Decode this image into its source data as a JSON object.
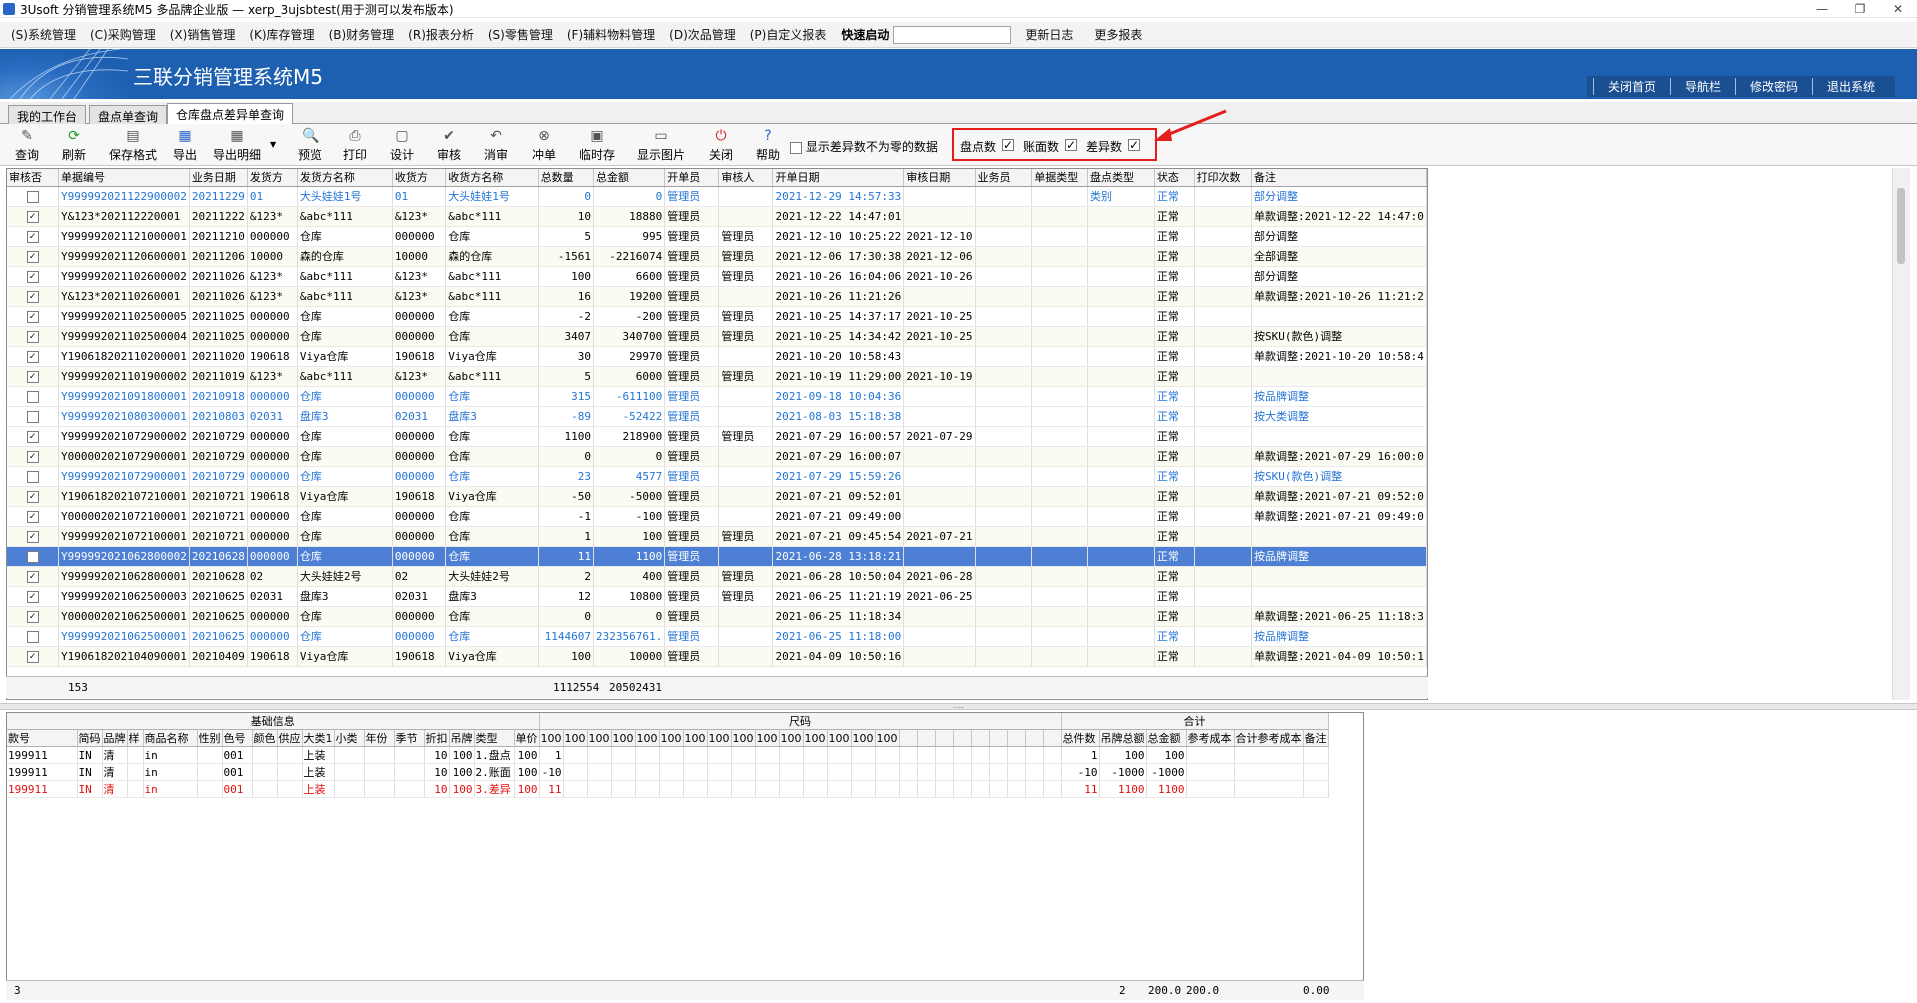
{
  "window": {
    "title": "3Usoft 分销管理系统M5 多品牌企业版 — xerp_3ujsbtest(用于测可以发布版本)",
    "controls": [
      "—",
      "❐",
      "✕"
    ]
  },
  "menubar": {
    "items": [
      "(S)系统管理",
      "(C)采购管理",
      "(X)销售管理",
      "(K)库存管理",
      "(B)财务管理",
      "(R)报表分析",
      "(S)零售管理",
      "(F)辅料物料管理",
      "(D)次品管理",
      "(P)自定义报表"
    ],
    "quick_label": "快速启动",
    "quick_value": "",
    "update_log": "更新日志",
    "more_reports": "更多报表"
  },
  "banner": {
    "title": "三联分销管理系统M5",
    "links": [
      "关闭首页",
      "导航栏",
      "修改密码",
      "退出系统"
    ]
  },
  "tabs": [
    "我的工作台",
    "盘点单查询",
    "仓库盘点差异单查询"
  ],
  "toolbar": {
    "buttons": [
      "查询",
      "刷新",
      "保存格式",
      "导出",
      "导出明细",
      "预览",
      "打印",
      "设计",
      "审核",
      "消审",
      "冲单",
      "临时存",
      "显示图片",
      "关闭",
      "帮助"
    ],
    "show_nonzero_label": "显示差异数不为零的数据",
    "show_nonzero_checked": false,
    "opts": [
      {
        "label": "盘点数",
        "checked": true
      },
      {
        "label": "账面数",
        "checked": true
      },
      {
        "label": "差异数",
        "checked": true
      }
    ]
  },
  "grid": {
    "columns": [
      "审核否",
      "单据编号",
      "业务日期",
      "发货方",
      "发货方名称",
      "收货方",
      "收货方名称",
      "总数量",
      "总金额",
      "开单员",
      "审核人",
      "开单日期",
      "审核日期",
      "业务员",
      "单据类型",
      "盘点类型",
      "状态",
      "打印次数",
      "备注"
    ],
    "rows": [
      {
        "chk": false,
        "style": "blue",
        "c": [
          "Y999992021122900002",
          "20211229",
          "01",
          "大头娃娃1号",
          "01",
          "大头娃娃1号",
          "0",
          "0",
          "管理员",
          "",
          "2021-12-29 14:57:33",
          "",
          "",
          "",
          "类别",
          "正常",
          "",
          "部分调整"
        ]
      },
      {
        "chk": true,
        "style": "alt",
        "c": [
          "Y&123*202112220001",
          "20211222",
          "&123*",
          "&abc*111",
          "&123*",
          "&abc*111",
          "10",
          "18880",
          "管理员",
          "",
          "2021-12-22 14:47:01",
          "",
          "",
          "",
          "",
          "正常",
          "",
          "单款调整:2021-12-22 14:47:0"
        ]
      },
      {
        "chk": true,
        "style": "",
        "c": [
          "Y999992021121000001",
          "20211210",
          "000000",
          "仓库",
          "000000",
          "仓库",
          "5",
          "995",
          "管理员",
          "管理员",
          "2021-12-10 10:25:22",
          "2021-12-10",
          "",
          "",
          "",
          "正常",
          "",
          "部分调整"
        ]
      },
      {
        "chk": true,
        "style": "alt",
        "c": [
          "Y999992021120600001",
          "20211206",
          "10000",
          "森的仓库",
          "10000",
          "森的仓库",
          "-1561",
          "-2216074",
          "管理员",
          "管理员",
          "2021-12-06 17:30:38",
          "2021-12-06",
          "",
          "",
          "",
          "正常",
          "",
          "全部调整"
        ]
      },
      {
        "chk": true,
        "style": "",
        "c": [
          "Y999992021102600002",
          "20211026",
          "&123*",
          "&abc*111",
          "&123*",
          "&abc*111",
          "100",
          "6600",
          "管理员",
          "管理员",
          "2021-10-26 16:04:06",
          "2021-10-26",
          "",
          "",
          "",
          "正常",
          "",
          "部分调整"
        ]
      },
      {
        "chk": true,
        "style": "alt",
        "c": [
          "Y&123*202110260001",
          "20211026",
          "&123*",
          "&abc*111",
          "&123*",
          "&abc*111",
          "16",
          "19200",
          "管理员",
          "",
          "2021-10-26 11:21:26",
          "",
          "",
          "",
          "",
          "正常",
          "",
          "单款调整:2021-10-26 11:21:2"
        ]
      },
      {
        "chk": true,
        "style": "",
        "c": [
          "Y999992021102500005",
          "20211025",
          "000000",
          "仓库",
          "000000",
          "仓库",
          "-2",
          "-200",
          "管理员",
          "管理员",
          "2021-10-25 14:37:17",
          "2021-10-25",
          "",
          "",
          "",
          "正常",
          "",
          ""
        ]
      },
      {
        "chk": true,
        "style": "alt",
        "c": [
          "Y999992021102500004",
          "20211025",
          "000000",
          "仓库",
          "000000",
          "仓库",
          "3407",
          "340700",
          "管理员",
          "管理员",
          "2021-10-25 14:34:42",
          "2021-10-25",
          "",
          "",
          "",
          "正常",
          "",
          "按SKU(款色)调整"
        ]
      },
      {
        "chk": true,
        "style": "",
        "c": [
          "Y190618202110200001",
          "20211020",
          "190618",
          "Viya仓库",
          "190618",
          "Viya仓库",
          "30",
          "29970",
          "管理员",
          "",
          "2021-10-20 10:58:43",
          "",
          "",
          "",
          "",
          "正常",
          "",
          "单款调整:2021-10-20 10:58:4"
        ]
      },
      {
        "chk": true,
        "style": "alt",
        "c": [
          "Y999992021101900002",
          "20211019",
          "&123*",
          "&abc*111",
          "&123*",
          "&abc*111",
          "5",
          "6000",
          "管理员",
          "管理员",
          "2021-10-19 11:29:00",
          "2021-10-19",
          "",
          "",
          "",
          "正常",
          "",
          ""
        ]
      },
      {
        "chk": false,
        "style": "blue",
        "c": [
          "Y999992021091800001",
          "20210918",
          "000000",
          "仓库",
          "000000",
          "仓库",
          "315",
          "-611100",
          "管理员",
          "",
          "2021-09-18 10:04:36",
          "",
          "",
          "",
          "",
          "正常",
          "",
          "按品牌调整"
        ]
      },
      {
        "chk": false,
        "style": "blue",
        "c": [
          "Y999992021080300001",
          "20210803",
          "02031",
          "盘库3",
          "02031",
          "盘库3",
          "-89",
          "-52422",
          "管理员",
          "",
          "2021-08-03 15:18:38",
          "",
          "",
          "",
          "",
          "正常",
          "",
          "按大类调整"
        ]
      },
      {
        "chk": true,
        "style": "",
        "c": [
          "Y999992021072900002",
          "20210729",
          "000000",
          "仓库",
          "000000",
          "仓库",
          "1100",
          "218900",
          "管理员",
          "管理员",
          "2021-07-29 16:00:57",
          "2021-07-29",
          "",
          "",
          "",
          "正常",
          "",
          ""
        ]
      },
      {
        "chk": true,
        "style": "alt",
        "c": [
          "Y000002021072900001",
          "20210729",
          "000000",
          "仓库",
          "000000",
          "仓库",
          "0",
          "0",
          "管理员",
          "",
          "2021-07-29 16:00:07",
          "",
          "",
          "",
          "",
          "正常",
          "",
          "单款调整:2021-07-29 16:00:0"
        ]
      },
      {
        "chk": false,
        "style": "blue",
        "c": [
          "Y999992021072900001",
          "20210729",
          "000000",
          "仓库",
          "000000",
          "仓库",
          "23",
          "4577",
          "管理员",
          "",
          "2021-07-29 15:59:26",
          "",
          "",
          "",
          "",
          "正常",
          "",
          "按SKU(款色)调整"
        ]
      },
      {
        "chk": true,
        "style": "alt",
        "c": [
          "Y190618202107210001",
          "20210721",
          "190618",
          "Viya仓库",
          "190618",
          "Viya仓库",
          "-50",
          "-5000",
          "管理员",
          "",
          "2021-07-21 09:52:01",
          "",
          "",
          "",
          "",
          "正常",
          "",
          "单款调整:2021-07-21 09:52:0"
        ]
      },
      {
        "chk": true,
        "style": "",
        "c": [
          "Y000002021072100001",
          "20210721",
          "000000",
          "仓库",
          "000000",
          "仓库",
          "-1",
          "-100",
          "管理员",
          "",
          "2021-07-21 09:49:00",
          "",
          "",
          "",
          "",
          "正常",
          "",
          "单款调整:2021-07-21 09:49:0"
        ]
      },
      {
        "chk": true,
        "style": "alt",
        "c": [
          "Y999992021072100001",
          "20210721",
          "000000",
          "仓库",
          "000000",
          "仓库",
          "1",
          "100",
          "管理员",
          "管理员",
          "2021-07-21 09:45:54",
          "2021-07-21",
          "",
          "",
          "",
          "正常",
          "",
          ""
        ]
      },
      {
        "chk": false,
        "style": "sel",
        "c": [
          "Y999992021062800002",
          "20210628",
          "000000",
          "仓库",
          "000000",
          "仓库",
          "11",
          "1100",
          "管理员",
          "",
          "2021-06-28 13:18:21",
          "",
          "",
          "",
          "",
          "正常",
          "",
          "按品牌调整"
        ]
      },
      {
        "chk": true,
        "style": "alt",
        "c": [
          "Y999992021062800001",
          "20210628",
          "02",
          "大头娃娃2号",
          "02",
          "大头娃娃2号",
          "2",
          "400",
          "管理员",
          "管理员",
          "2021-06-28 10:50:04",
          "2021-06-28",
          "",
          "",
          "",
          "正常",
          "",
          ""
        ]
      },
      {
        "chk": true,
        "style": "",
        "c": [
          "Y999992021062500003",
          "20210625",
          "02031",
          "盘库3",
          "02031",
          "盘库3",
          "12",
          "10800",
          "管理员",
          "管理员",
          "2021-06-25 11:21:19",
          "2021-06-25",
          "",
          "",
          "",
          "正常",
          "",
          ""
        ]
      },
      {
        "chk": true,
        "style": "alt",
        "c": [
          "Y000002021062500001",
          "20210625",
          "000000",
          "仓库",
          "000000",
          "仓库",
          "0",
          "0",
          "管理员",
          "",
          "2021-06-25 11:18:34",
          "",
          "",
          "",
          "",
          "正常",
          "",
          "单款调整:2021-06-25 11:18:3"
        ]
      },
      {
        "chk": false,
        "style": "blue",
        "c": [
          "Y999992021062500001",
          "20210625",
          "000000",
          "仓库",
          "000000",
          "仓库",
          "1144607",
          "232356761.",
          "管理员",
          "",
          "2021-06-25 11:18:00",
          "",
          "",
          "",
          "",
          "正常",
          "",
          "按品牌调整"
        ]
      },
      {
        "chk": true,
        "style": "alt",
        "c": [
          "Y190618202104090001",
          "20210409",
          "190618",
          "Viya仓库",
          "190618",
          "Viya仓库",
          "100",
          "10000",
          "管理员",
          "",
          "2021-04-09 10:50:16",
          "",
          "",
          "",
          "",
          "正常",
          "",
          "单款调整:2021-04-09 10:50:1"
        ]
      }
    ],
    "footer": {
      "count": "153",
      "total_qty": "1112554",
      "total_amount": "20502431"
    }
  },
  "detail": {
    "group_headers": [
      "基础信息",
      "尺码",
      "合计"
    ],
    "columns": [
      "款号",
      "简码",
      "品牌",
      "样",
      "商品名称",
      "性别",
      "色号",
      "颜色",
      "供应",
      "大类1",
      "小类",
      "年份",
      "季节",
      "折扣",
      "吊牌",
      "类型",
      "单价"
    ],
    "size_headers": [
      "100",
      "100",
      "100",
      "100",
      "100",
      "100",
      "100",
      "100",
      "100",
      "100",
      "100",
      "100",
      "100",
      "100",
      "100",
      "",
      "",
      "",
      "",
      "",
      "",
      "",
      "",
      ""
    ],
    "total_columns": [
      "总件数",
      "吊牌总额",
      "总金额",
      "参考成本",
      "合计参考成本",
      "备注"
    ],
    "rows": [
      {
        "style": "",
        "c": [
          "199911",
          "IN",
          "清",
          "",
          "in",
          "",
          "001",
          "",
          "",
          "上装",
          "",
          "",
          "",
          "10",
          "100",
          "1.盘点",
          "100"
        ],
        "sizes": [
          "1"
        ],
        "totals": [
          "1",
          "100",
          "100",
          "",
          "",
          ""
        ]
      },
      {
        "style": "",
        "c": [
          "199911",
          "IN",
          "清",
          "",
          "in",
          "",
          "001",
          "",
          "",
          "上装",
          "",
          "",
          "",
          "10",
          "100",
          "2.账面",
          "100"
        ],
        "sizes": [
          "-10"
        ],
        "totals": [
          "-10",
          "-1000",
          "-1000",
          "",
          "",
          ""
        ]
      },
      {
        "style": "red",
        "c": [
          "199911",
          "IN",
          "清",
          "",
          "in",
          "",
          "001",
          "",
          "",
          "上装",
          "",
          "",
          "",
          "10",
          "100",
          "3.差异",
          "100"
        ],
        "sizes": [
          "11"
        ],
        "totals": [
          "11",
          "1100",
          "1100",
          "",
          "",
          ""
        ]
      }
    ],
    "footer": {
      "count": "3",
      "sum_qty": "2",
      "sum_tag": "200.0",
      "sum_amount": "200.0",
      "ref_cost": "0.00"
    }
  }
}
